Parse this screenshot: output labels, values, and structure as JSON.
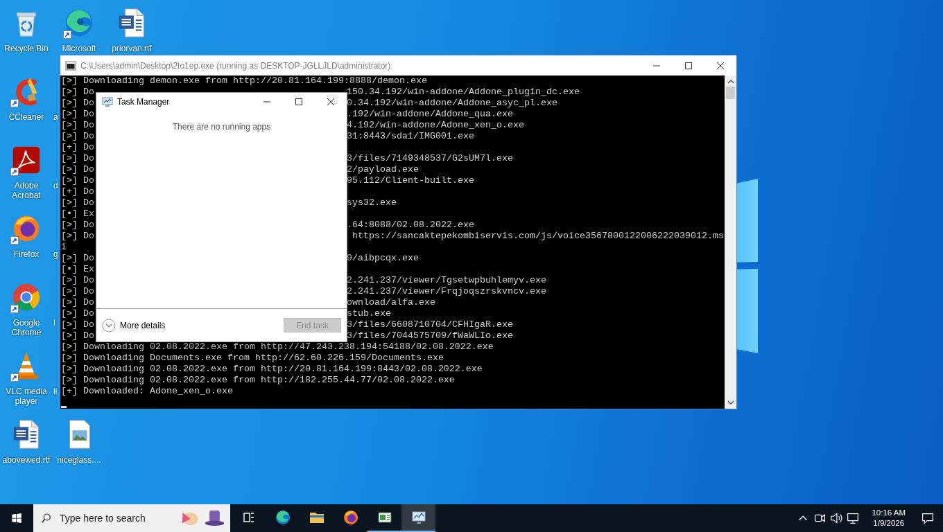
{
  "desktop": {
    "columns": [
      [
        {
          "label": "Recycle Bin",
          "kind": "recycle",
          "shortcut": false
        },
        {
          "label": "CCleaner",
          "kind": "ccleaner",
          "shortcut": true
        },
        {
          "label": "Adobe Acrobat",
          "kind": "acrobat",
          "shortcut": true
        },
        {
          "label": "Firefox",
          "kind": "firefox",
          "shortcut": true
        },
        {
          "label": "Google Chrome",
          "kind": "chrome",
          "shortcut": true
        },
        {
          "label": "VLC media player",
          "kind": "vlc",
          "shortcut": true
        },
        {
          "label": "abovewed.rtf",
          "kind": "word",
          "shortcut": false
        }
      ],
      [
        {
          "label": "Microsoft",
          "kind": "edge",
          "shortcut": true
        },
        {
          "label": "a",
          "kind": "covered"
        },
        {
          "label": "d",
          "kind": "covered"
        },
        {
          "label": "g",
          "kind": "covered"
        },
        {
          "label": "l",
          "kind": "covered"
        },
        {
          "label": "li",
          "kind": "covered"
        },
        {
          "label": "niceglass....",
          "kind": "image",
          "shortcut": false
        }
      ],
      [
        {
          "label": "priorvan.rtf",
          "kind": "word",
          "shortcut": false
        }
      ]
    ]
  },
  "console": {
    "title": "C:\\Users\\admin\\Desktop\\2to1ep.exe (running as DESKTOP-JGLLJLD\\administrator)",
    "lines": [
      {
        "text": "[>] Downloading demon.exe from http://20.81.164.199:8888/demon.exe"
      },
      {
        "text": "[>] Do",
        "tail": "150.34.192/win-addone/Addone_plugin_dc.exe"
      },
      {
        "text": "[>] Do",
        "tail": "0.34.192/win-addone/Addone_asyc_pl.exe"
      },
      {
        "text": "[>] Do",
        "tail": ".192/win-addone/Addone_qua.exe"
      },
      {
        "text": "[>] Do",
        "tail": "4.192/win-addone/Adone_xen_o.exe"
      },
      {
        "text": "[>] Do",
        "tail": "31:8443/sda1/IMG001.exe"
      },
      {
        "text": "[+] Do"
      },
      {
        "text": "[>] Do",
        "tail": "3/files/7149348537/G2sUM7l.exe"
      },
      {
        "text": "[>] Do",
        "tail": "2/payload.exe"
      },
      {
        "text": "[>] Do",
        "tail": "95.112/Client-built.exe"
      },
      {
        "text": "[+] Do"
      },
      {
        "text": "[>] Do",
        "tail": "sys32.exe"
      },
      {
        "text": "[•] Ex"
      },
      {
        "text": "[>] Do",
        "tail": ".64:8088/02.08.2022.exe"
      },
      {
        "text": "[>] Do",
        "tail": " https://sancaktepekombiservis.com/js/voice3567800122006222039012.ms"
      },
      {
        "text": "i"
      },
      {
        "text": "[>] Do",
        "tail": "9/aibpcqx.exe"
      },
      {
        "text": "[•] Ex"
      },
      {
        "text": "[>] Do",
        "tail": "2.241.237/viewer/Tgsetwpbuhlemyv.exe"
      },
      {
        "text": "[>] Do",
        "tail": "2.241.237/viewer/Frqjoqszrskvncv.exe"
      },
      {
        "text": "[>] Do",
        "tail": "ownload/alfa.exe"
      },
      {
        "text": "[>] Do",
        "tail": "stub.exe"
      },
      {
        "text": "[>] Do",
        "tail": "3/files/6608710704/CFHIgaR.exe"
      },
      {
        "text": "[>] Do",
        "tail": "3/files/7044575709/fWaWLIo.exe"
      },
      {
        "text": "[>] Downloading 02.08.2022.exe from http://47.243.238.194:54188/02.08.2022.exe"
      },
      {
        "text": "[>] Downloading Documents.exe from http://62.60.226.159/Documents.exe"
      },
      {
        "text": "[>] Downloading 02.08.2022.exe from http://20.81.164.199:8443/02.08.2022.exe"
      },
      {
        "text": "[>] Downloading 02.08.2022.exe from http://182.255.44.77/02.08.2022.exe"
      },
      {
        "text": "[+] Downloaded: Adone_xen_o.exe"
      }
    ]
  },
  "task_manager": {
    "title": "Task Manager",
    "message": "There are no running apps",
    "more_details": "More details",
    "end_task": {
      "label": "End task",
      "disabled": true
    }
  },
  "taskbar": {
    "search": {
      "placeholder": "Type here to search"
    },
    "apps": [
      {
        "kind": "taskview",
        "running": false,
        "selected": false
      },
      {
        "kind": "edge",
        "running": false,
        "selected": false
      },
      {
        "kind": "folder",
        "running": false,
        "selected": false
      },
      {
        "kind": "firefox",
        "running": false,
        "selected": false
      },
      {
        "kind": "app",
        "running": true,
        "selected": false
      },
      {
        "kind": "taskmgr",
        "running": true,
        "selected": true
      }
    ],
    "clock": {
      "time": "10:16 AM",
      "date": "1/9/2026"
    }
  }
}
